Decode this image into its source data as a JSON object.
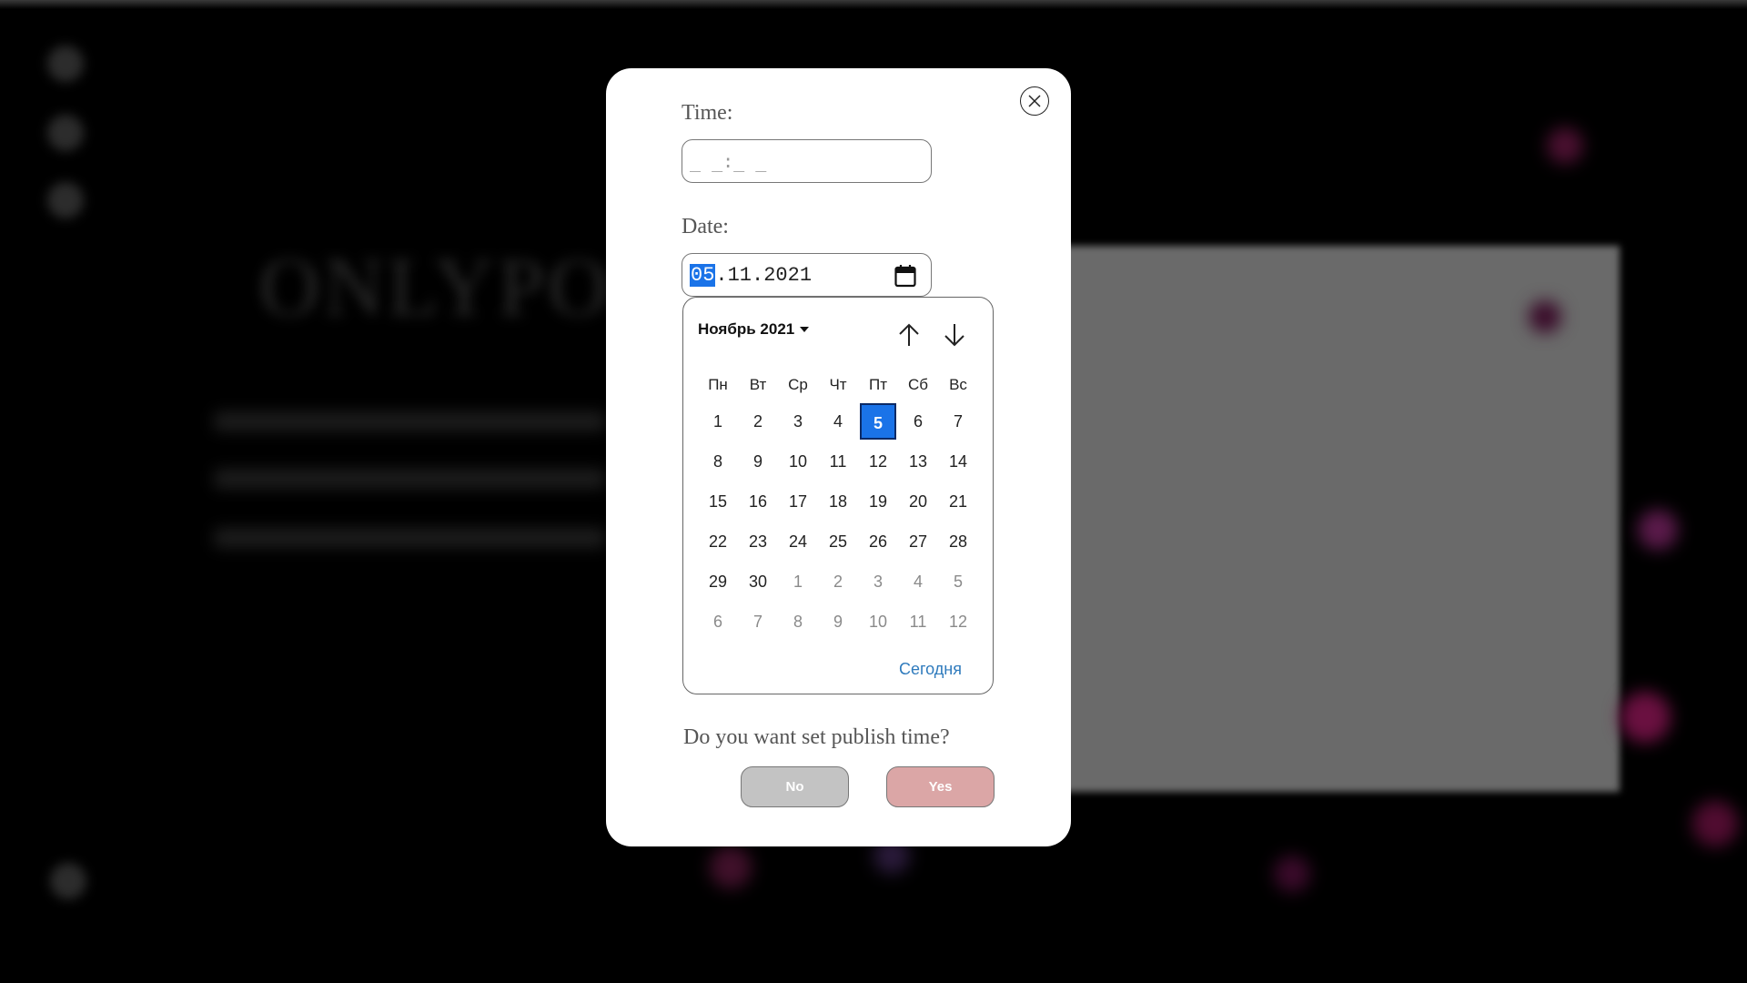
{
  "background": {
    "logo_text": "ONLYPOS"
  },
  "modal": {
    "time_label": "Time:",
    "time_placeholder": "_ _:_ _",
    "date_label": "Date:",
    "date_day": "05",
    "date_rest": ".11.2021",
    "calendar": {
      "month_label": "Ноябрь 2021",
      "weekdays": [
        "Пн",
        "Вт",
        "Ср",
        "Чт",
        "Пт",
        "Сб",
        "Вс"
      ],
      "weeks": [
        [
          "1",
          "2",
          "3",
          "4",
          "5",
          "6",
          "7"
        ],
        [
          "8",
          "9",
          "10",
          "11",
          "12",
          "13",
          "14"
        ],
        [
          "15",
          "16",
          "17",
          "18",
          "19",
          "20",
          "21"
        ],
        [
          "22",
          "23",
          "24",
          "25",
          "26",
          "27",
          "28"
        ],
        [
          "29",
          "30",
          "1",
          "2",
          "3",
          "4",
          "5"
        ],
        [
          "6",
          "7",
          "8",
          "9",
          "10",
          "11",
          "12"
        ]
      ],
      "selected_day": "5",
      "today_label": "Сегодня"
    },
    "question": "Do you want set publish time?",
    "no_label": "No",
    "yes_label": "Yes"
  },
  "colors": {
    "accent": "#1a73e8",
    "no_button": "#c3c3c3",
    "yes_button": "#dba6a6",
    "today_link": "#2f7bbd"
  }
}
